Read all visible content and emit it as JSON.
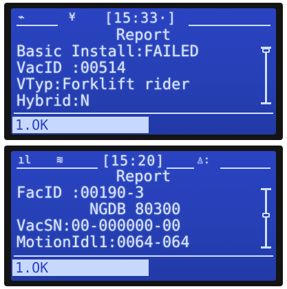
{
  "screens": [
    {
      "status": {
        "icon_left": "sync-icon",
        "icon_left_glyph": "⌁",
        "icon_mid": "antenna-icon",
        "icon_mid_glyph": "¥",
        "time": "[15:33·]"
      },
      "title": "Report",
      "rows": [
        "Basic Install:FAILED",
        "VacID :00514",
        "VTyp:Forklift rider",
        "Hybrid:N"
      ],
      "softkey": "1.OK"
    },
    {
      "status": {
        "icon_left": "signal-bars-icon",
        "icon_left_glyph": "ıl",
        "icon_mid": "wifi-icon",
        "icon_mid_glyph": "≋",
        "time": "[15:20]",
        "icon_right": "person-icon",
        "icon_right_glyph": "♙:"
      },
      "title": "Report",
      "rows": [
        "FacID :00190-3",
        "        NGDB 80300",
        "VacSN:00-000000-00",
        "MotionIdl1:0064-064"
      ],
      "softkey": "1.OK"
    }
  ]
}
